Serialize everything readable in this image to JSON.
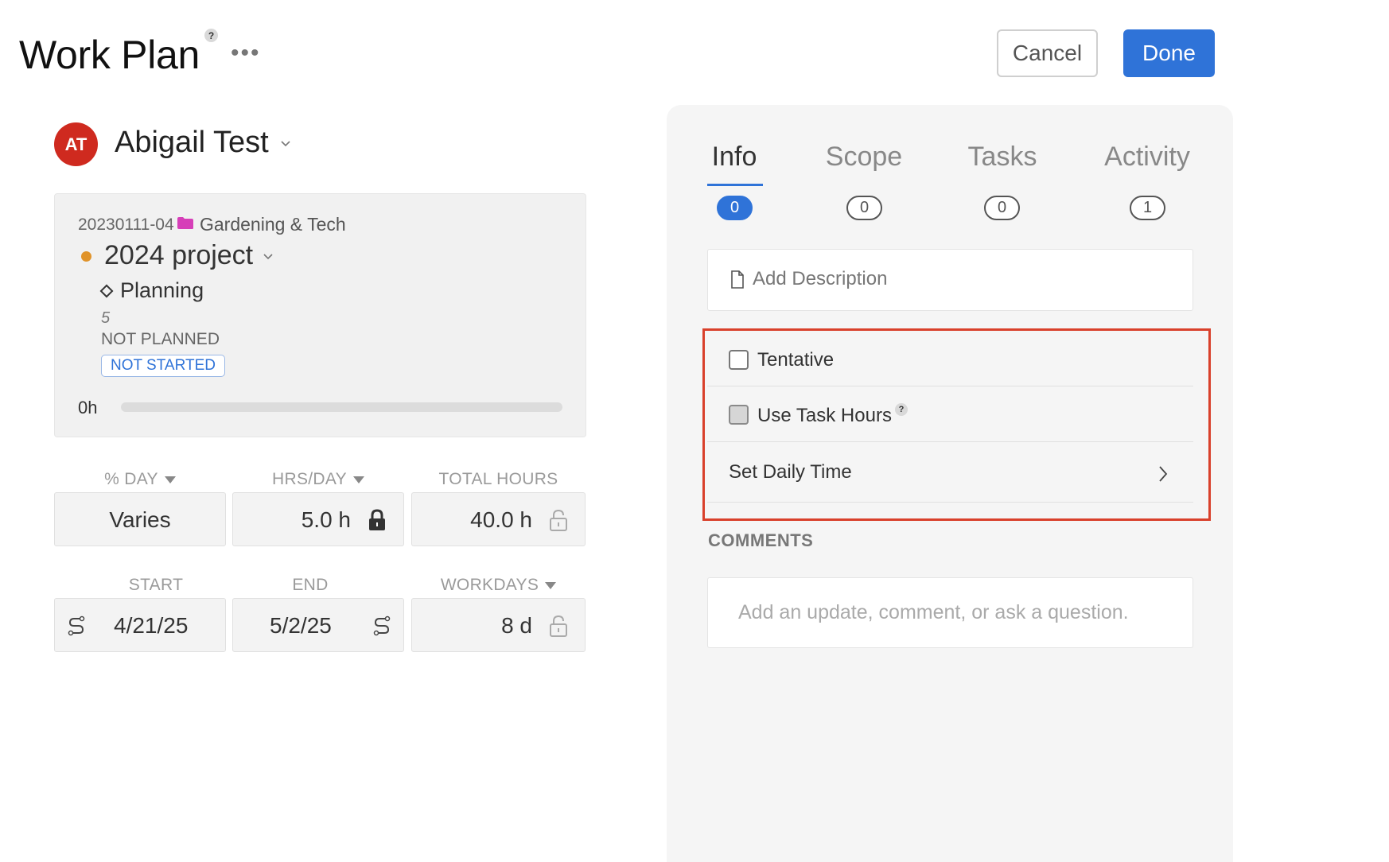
{
  "header": {
    "title": "Work Plan",
    "help": "?",
    "more": "•••",
    "cancel_label": "Cancel",
    "done_label": "Done"
  },
  "user": {
    "initials": "AT",
    "name": "Abigail Test",
    "avatar_color": "#cf2a1f"
  },
  "project": {
    "code": "20230111-04",
    "client": "Gardening & Tech",
    "name": "2024 project",
    "phase": "Planning",
    "number": "5",
    "plan_status": "NOT PLANNED",
    "work_status": "NOT STARTED",
    "hours_used": "0h",
    "progress_fraction": 0,
    "status_dot_color": "#e0932a",
    "folder_color": "#d63fb8"
  },
  "fields": {
    "pct_day_label": "% DAY",
    "hrs_day_label": "HRS/DAY",
    "total_hours_label": "TOTAL HOURS",
    "pct_day_value": "Varies",
    "hrs_day_value": "5.0 h",
    "total_hours_value": "40.0 h",
    "start_label": "START",
    "end_label": "END",
    "workdays_label": "WORKDAYS",
    "start_value": "4/21/25",
    "end_value": "5/2/25",
    "workdays_value": "8 d"
  },
  "tabs": [
    {
      "label": "Info",
      "count": "0",
      "active": true
    },
    {
      "label": "Scope",
      "count": "0",
      "active": false
    },
    {
      "label": "Tasks",
      "count": "0",
      "active": false
    },
    {
      "label": "Activity",
      "count": "1",
      "active": false
    }
  ],
  "panel": {
    "description_placeholder": "Add Description",
    "tentative_label": "Tentative",
    "use_task_hours_label": "Use Task Hours",
    "set_daily_time_label": "Set Daily Time",
    "comments_label": "COMMENTS",
    "comment_placeholder": "Add an update, comment, or ask a question."
  },
  "colors": {
    "accent": "#2f73d8",
    "highlight_border": "#d9402b"
  }
}
